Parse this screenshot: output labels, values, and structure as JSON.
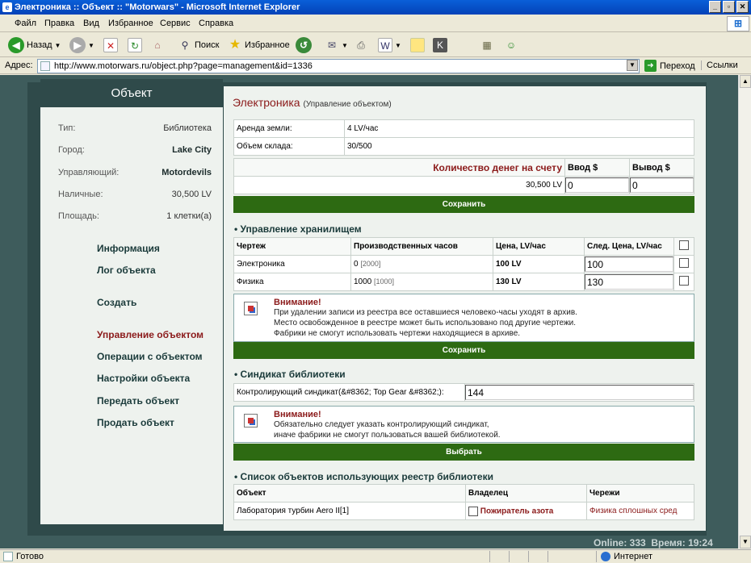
{
  "window": {
    "title": "Электроника :: Объект :: \"Motorwars\" - Microsoft Internet Explorer"
  },
  "menu": [
    "Файл",
    "Правка",
    "Вид",
    "Избранное",
    "Сервис",
    "Справка"
  ],
  "toolbar": {
    "back": "Назад",
    "search": "Поиск",
    "favorites": "Избранное"
  },
  "address": {
    "label": "Адрес:",
    "url": "http://www.motorwars.ru/object.php?page=management&id=1336",
    "go": "Переход",
    "links": "Ссылки"
  },
  "sidebar": {
    "title": "Объект",
    "info": [
      {
        "label": "Тип:",
        "value": "Библиотека"
      },
      {
        "label": "Город:",
        "value": "Lake City"
      },
      {
        "label": "Управляющий:",
        "value": "Motordevils"
      },
      {
        "label": "Наличные:",
        "value": "30,500 LV"
      },
      {
        "label": "Площадь:",
        "value": "1 клетки(а)"
      }
    ],
    "nav": [
      "Информация",
      "Лог объекта",
      "Создать",
      "Управление объектом",
      "Операции с объектом",
      "Настройки объекта",
      "Передать объект",
      "Продать объект"
    ]
  },
  "page": {
    "title": "Электроника",
    "subtitle": "(Управление объектом)"
  },
  "summary": {
    "rent_label": "Аренда земли:",
    "rent_value": "4 LV/час",
    "storage_label": "Объем склада:",
    "storage_value": "30/500",
    "money_label": "Количество денег на счету",
    "deposit_label": "Ввод $",
    "withdraw_label": "Вывод $",
    "money_value": "30,500 LV",
    "deposit_value": "0",
    "withdraw_value": "0",
    "save": "Сохранить"
  },
  "storage": {
    "section": "Управление хранилищем",
    "headers": [
      "Чертеж",
      "Производственных часов",
      "Цена, LV/час",
      "След. Цена, LV/час"
    ],
    "rows": [
      {
        "name": "Электроника",
        "hours": "0",
        "hours_extra": "[2000]",
        "price": "100 LV",
        "next": "100"
      },
      {
        "name": "Физика",
        "hours": "1000",
        "hours_extra": "[1000]",
        "price": "130 LV",
        "next": "130"
      }
    ],
    "warn_title": "Внимание!",
    "warn_lines": [
      "При удалении записи из реестра все оставшиеся человеко-часы уходят в архив.",
      "Место освобожденное в реестре может быть использовано под другие чертежи.",
      "Фабрики не смогут использовать чертежи находящиеся в архиве."
    ],
    "save": "Сохранить"
  },
  "syndicate": {
    "section": "Синдикат библиотеки",
    "label": "Контролирующий синдикат(&#8362; Top Gear &#8362;):",
    "value": "144",
    "warn_title": "Внимание!",
    "warn_lines": [
      "Обязательно следует указать контролирующий синдикат,",
      "иначе фабрики не смогут пользоваться вашей библиотекой."
    ],
    "choose": "Выбрать"
  },
  "users": {
    "section": "Список объектов использующих реестр библиотеки",
    "headers": [
      "Объект",
      "Владелец",
      "Черeжи"
    ],
    "rows": [
      {
        "object": "Лаборатория турбин Aero II[1]",
        "owner": "Пожиратель азота",
        "blueprints": "Физика сплошных сред"
      }
    ]
  },
  "footer": {
    "online": "Online: 333",
    "time": "Время: 19:24"
  },
  "status": {
    "left": "Готово",
    "zone": "Интернет"
  }
}
